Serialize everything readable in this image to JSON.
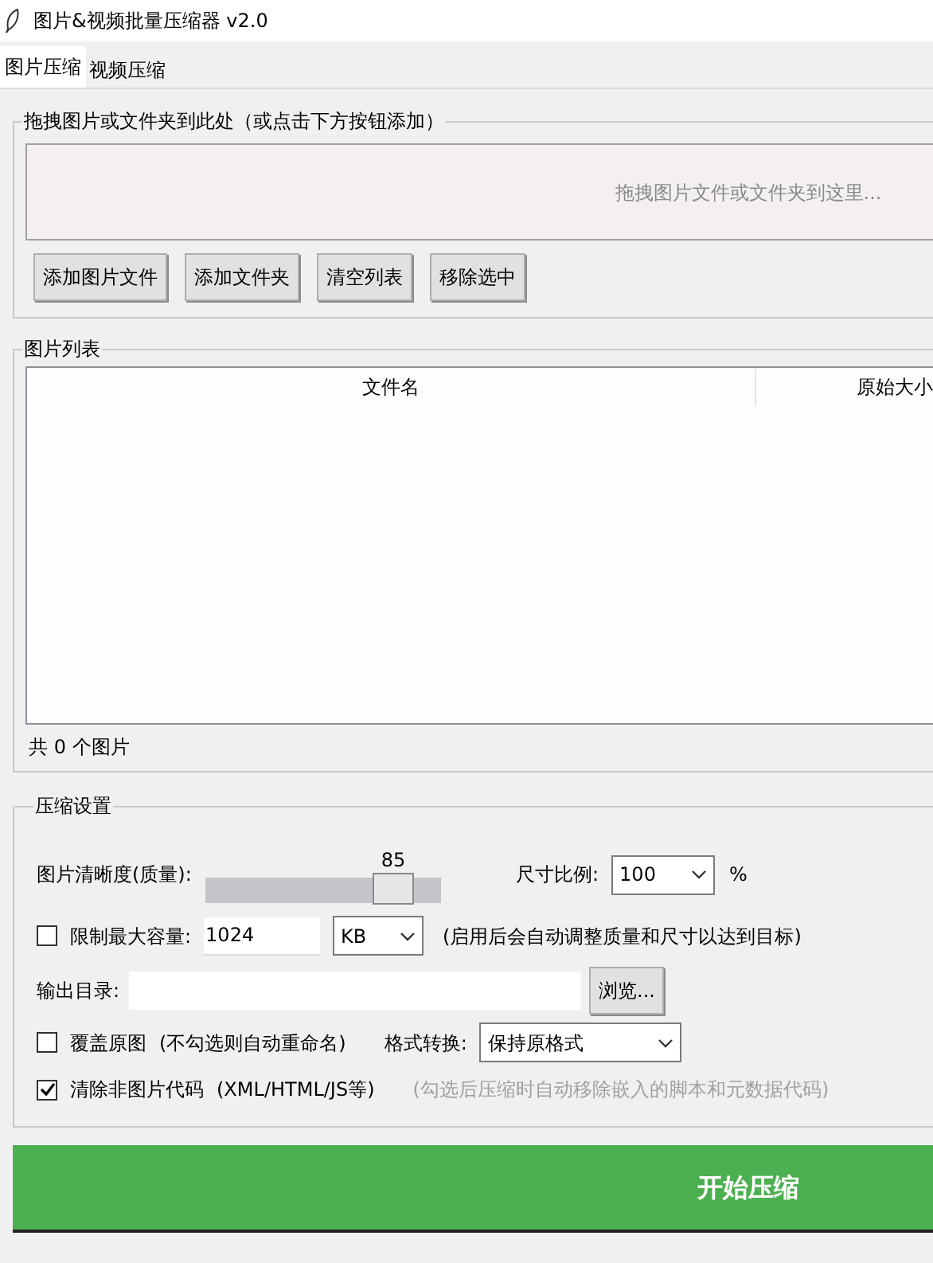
{
  "window": {
    "title": "图片&视频批量压缩器 v2.0"
  },
  "tabs": [
    {
      "label": "图片压缩",
      "selected": true
    },
    {
      "label": "视频压缩",
      "selected": false
    }
  ],
  "drop_group": {
    "title": "拖拽图片或文件夹到此处（或点击下方按钮添加）",
    "prompt": "拖拽图片文件或文件夹到这里...",
    "buttons": [
      "添加图片文件",
      "添加文件夹",
      "清空列表",
      "移除选中"
    ]
  },
  "list_group": {
    "title": "图片列表",
    "columns": [
      "文件名",
      "原始大小"
    ],
    "count": "共 0 个图片"
  },
  "settings": {
    "title": "压缩设置",
    "quality": {
      "label": "图片清晰度(质量):",
      "value": "85",
      "level": 0.8
    },
    "scale": {
      "label": "尺寸比例:",
      "value": "100",
      "unit": "%"
    },
    "limit": {
      "label": "限制最大容量:",
      "checked": false,
      "value": "1024",
      "unit": "KB",
      "hint": "(启用后会自动调整质量和尺寸以达到目标)"
    },
    "output": {
      "label": "输出目录:",
      "button": "浏览..."
    },
    "overwrite": {
      "label": "覆盖原图",
      "checked": false,
      "hint": "(不勾选则自动重命名)"
    },
    "format": {
      "label": "格式转换:",
      "value": "保持原格式"
    },
    "clean": {
      "label": "清除非图片代码",
      "checked": true,
      "hint": "(XML/HTML/JS等)",
      "note": "(勾选后压缩时自动移除嵌入的脚本和元数据代码)"
    }
  },
  "start_button": "开始压缩"
}
